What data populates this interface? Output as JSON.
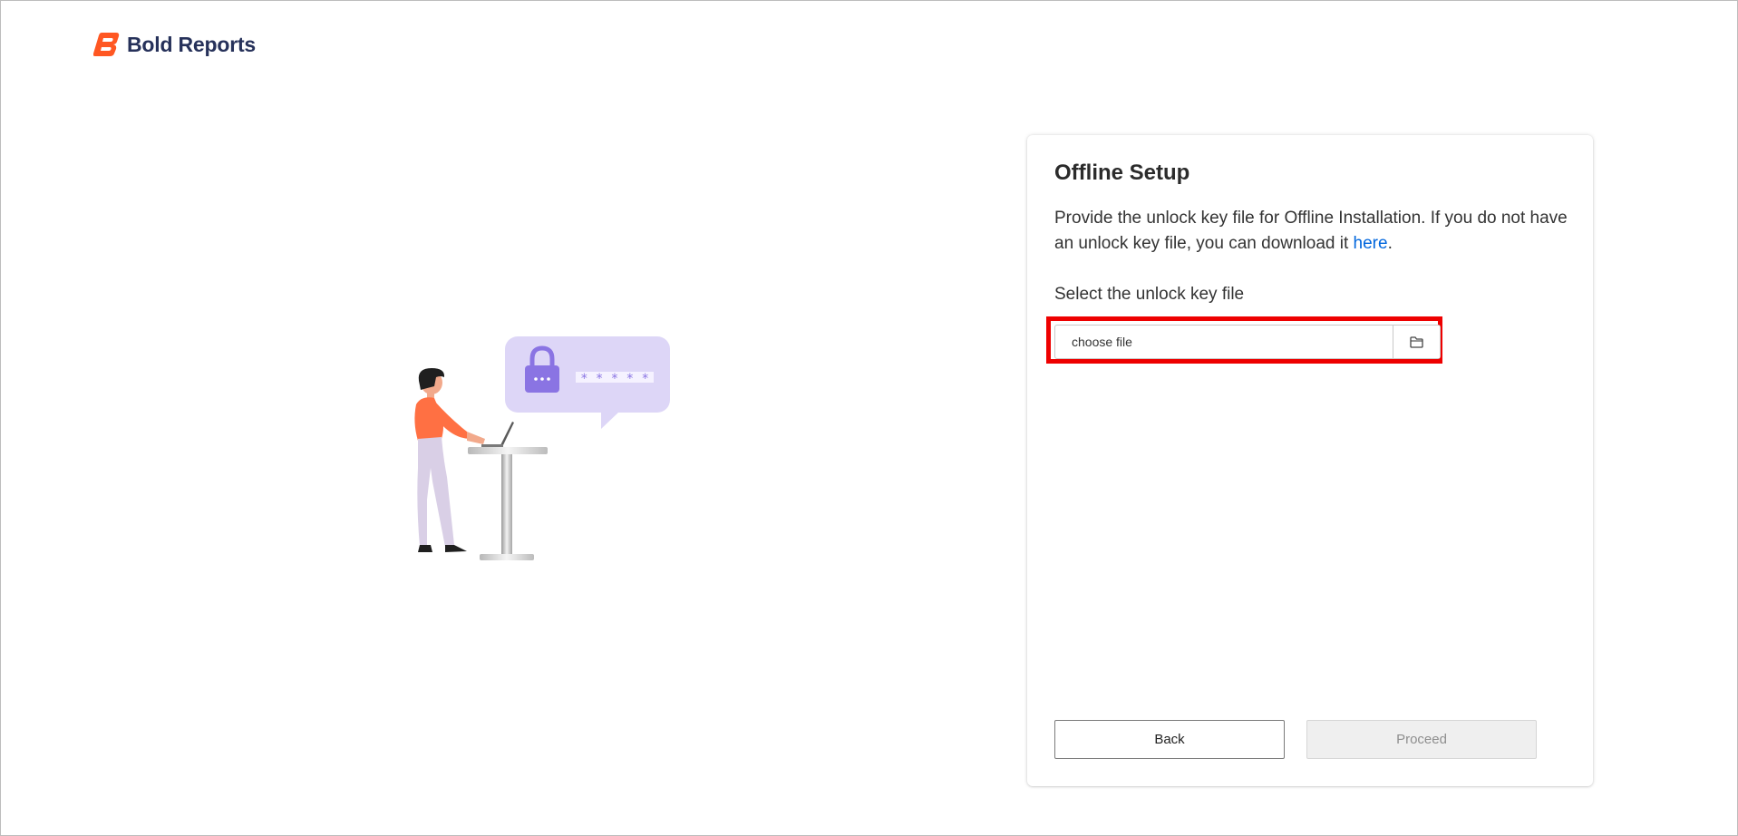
{
  "brand": {
    "name": "Bold Reports",
    "logo_icon": "bold-reports-logo-icon",
    "accent_color": "#ff5722",
    "text_color": "#26315a"
  },
  "illustration": {
    "password_mask": "* * * * *",
    "lock_icon": "lock-icon"
  },
  "card": {
    "title": "Offline Setup",
    "description_prefix": "Provide the unlock key file for Offline Installation. If you do not have an unlock key file, you can download it ",
    "description_link": "here",
    "description_suffix": ".",
    "file_label": "Select the unlock key file",
    "file_placeholder": "choose file",
    "browse_icon": "folder-icon",
    "highlight_color": "#ee0000"
  },
  "actions": {
    "back_label": "Back",
    "proceed_label": "Proceed"
  }
}
